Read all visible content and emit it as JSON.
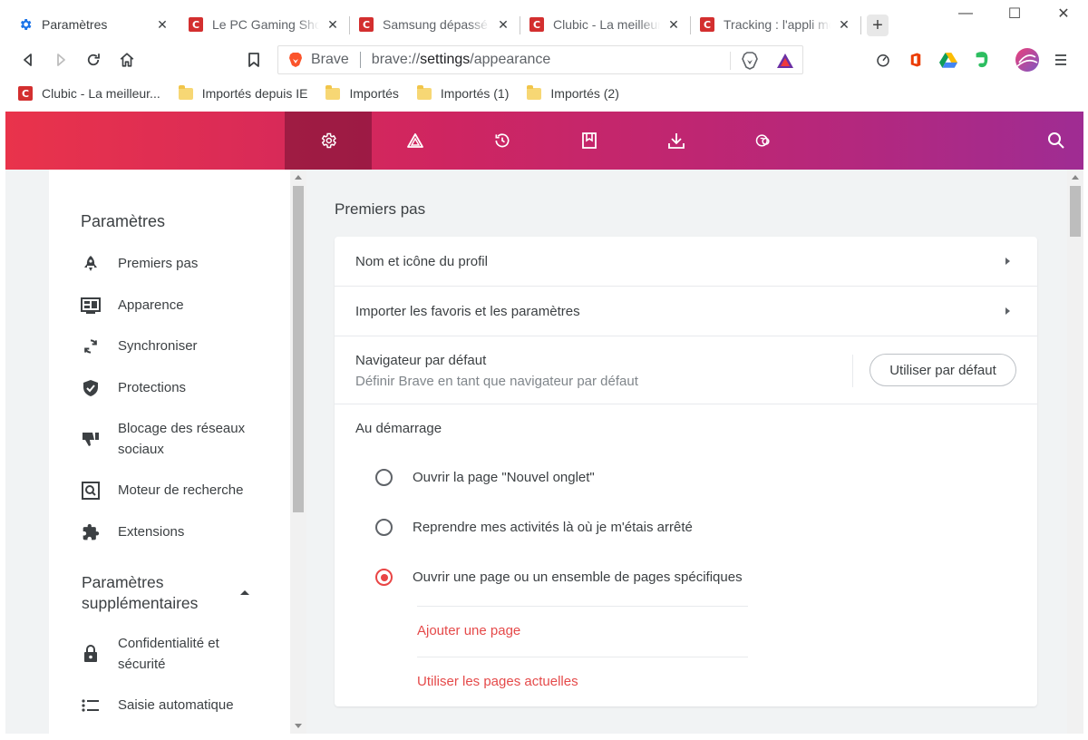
{
  "window": {
    "minimize": "—",
    "maximize": "☐",
    "close": "✕"
  },
  "tabs": [
    {
      "title": "Paramètres",
      "favicon": "gear-icon",
      "active": true
    },
    {
      "title": "Le PC Gaming Show",
      "favicon": "clubic-icon",
      "active": false
    },
    {
      "title": "Samsung dépassé p",
      "favicon": "clubic-icon",
      "active": false
    },
    {
      "title": "Clubic - La meilleure",
      "favicon": "clubic-icon",
      "active": false
    },
    {
      "title": "Tracking : l'appli mo",
      "favicon": "clubic-icon",
      "active": false
    }
  ],
  "clubic_letter": "C",
  "toolbar": {
    "brand": "Brave",
    "url_prefix": "brave://",
    "url_host": "settings",
    "url_path": "/appearance"
  },
  "bookmarks": [
    {
      "label": "Clubic - La meilleur...",
      "type": "site"
    },
    {
      "label": "Importés depuis IE",
      "type": "folder"
    },
    {
      "label": "Importés",
      "type": "folder"
    },
    {
      "label": "Importés (1)",
      "type": "folder"
    },
    {
      "label": "Importés (2)",
      "type": "folder"
    }
  ],
  "header": {
    "icons": [
      "gear-icon",
      "rewards-triangle-icon",
      "history-icon",
      "bookmarks-icon",
      "downloads-icon",
      "wallet-icon"
    ],
    "active_index": 0,
    "gradient_start": "#e9334b",
    "gradient_end": "#9f2c93"
  },
  "sidebar": {
    "title": "Paramètres",
    "items": [
      {
        "label": "Premiers pas",
        "icon": "rocket-icon"
      },
      {
        "label": "Apparence",
        "icon": "appearance-icon"
      },
      {
        "label": "Synchroniser",
        "icon": "sync-icon"
      },
      {
        "label": "Protections",
        "icon": "shield-icon"
      },
      {
        "label": "Blocage des réseaux",
        "label2": "sociaux",
        "icon": "thumbs-down-icon"
      },
      {
        "label": "Moteur de recherche",
        "icon": "search-engine-icon"
      },
      {
        "label": "Extensions",
        "icon": "puzzle-icon"
      }
    ],
    "more_title_1": "Paramètres",
    "more_title_2": "supplémentaires",
    "more_items": [
      {
        "label": "Confidentialité et",
        "label2": "sécurité",
        "icon": "lock-icon"
      },
      {
        "label": "Saisie automatique",
        "icon": "list-icon"
      }
    ]
  },
  "main": {
    "section_title": "Premiers pas",
    "rows": {
      "profile": "Nom et icône du profil",
      "import": "Importer les favoris et les paramètres",
      "default_browser": "Navigateur par défaut",
      "default_browser_sub": "Définir Brave en tant que navigateur par défaut",
      "default_button": "Utiliser par défaut"
    },
    "startup": {
      "title": "Au démarrage",
      "options": [
        {
          "label": "Ouvrir la page \"Nouvel onglet\"",
          "checked": false
        },
        {
          "label": "Reprendre mes activités là où je m'étais arrêté",
          "checked": false
        },
        {
          "label": "Ouvrir une page ou un ensemble de pages spécifiques",
          "checked": true
        }
      ],
      "add_page": "Ajouter une page",
      "use_current": "Utiliser les pages actuelles"
    }
  },
  "accent_color": "#e54a4a"
}
